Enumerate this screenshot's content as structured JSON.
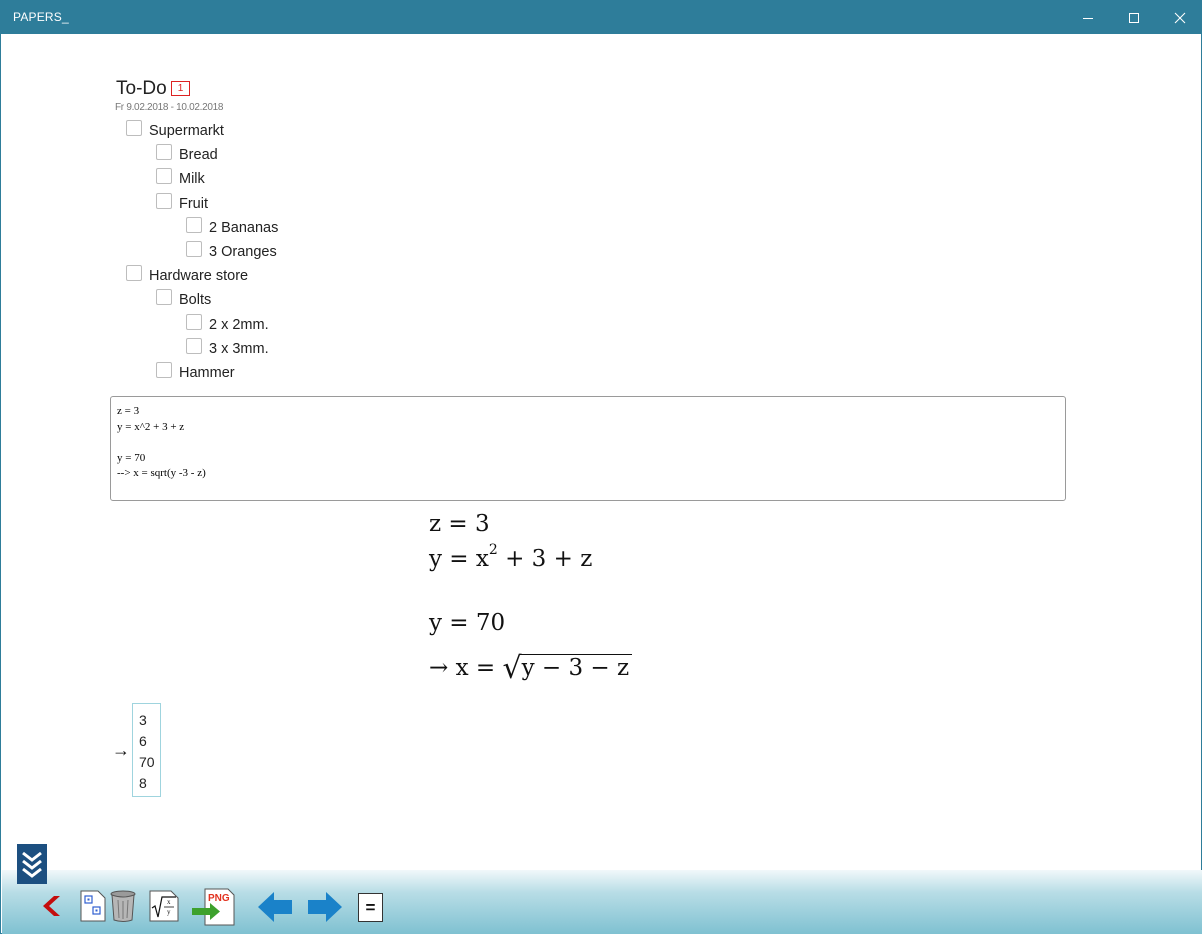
{
  "window": {
    "title": "PAPERS_",
    "minimize_icon": "minimize-icon",
    "maximize_icon": "maximize-icon",
    "close_icon": "close-icon",
    "titlebar_color": "#2e7d9a"
  },
  "todo": {
    "title": "To-Do",
    "badge": "1",
    "date_range": "Fr 9.02.2018 - 10.02.2018",
    "items": [
      {
        "label": "Supermarkt",
        "level": 0,
        "checked": false
      },
      {
        "label": "Bread",
        "level": 1,
        "checked": false
      },
      {
        "label": "Milk",
        "level": 1,
        "checked": false
      },
      {
        "label": "Fruit",
        "level": 1,
        "checked": false
      },
      {
        "label": "2 Bananas",
        "level": 2,
        "checked": false
      },
      {
        "label": "3 Oranges",
        "level": 2,
        "checked": false
      },
      {
        "label": "Hardware store",
        "level": 0,
        "checked": false
      },
      {
        "label": "Bolts",
        "level": 1,
        "checked": false
      },
      {
        "label": "2 x 2mm.",
        "level": 2,
        "checked": false
      },
      {
        "label": "3 x 3mm.",
        "level": 2,
        "checked": false
      },
      {
        "label": "Hammer",
        "level": 1,
        "checked": false
      }
    ]
  },
  "editor": {
    "lines": [
      "z = 3",
      "y = x^2 + 3 + z",
      "",
      "y = 70",
      "--> x = sqrt(y -3 - z)"
    ]
  },
  "math": {
    "line1": "z = 3",
    "line2_pre": "y = x",
    "line2_exp": "2",
    "line2_post": " + 3 + z",
    "line3": "y = 70",
    "line4_pre": "→ x = ",
    "line4_rad": "y − 3 − z"
  },
  "result": {
    "arrow": "→",
    "values": [
      "3",
      "6",
      "70",
      "8"
    ]
  },
  "toolbar": {
    "buttons": [
      {
        "icon": "back-chevron-icon"
      },
      {
        "icon": "new-page-icon"
      },
      {
        "icon": "trash-icon"
      },
      {
        "icon": "formula-icon"
      },
      {
        "icon": "export-png-icon",
        "label": "PNG"
      },
      {
        "icon": "arrow-left-icon"
      },
      {
        "icon": "arrow-right-icon"
      },
      {
        "icon": "equals-icon",
        "label": "="
      }
    ],
    "collapse_icon": "collapse-chevrons-icon"
  }
}
